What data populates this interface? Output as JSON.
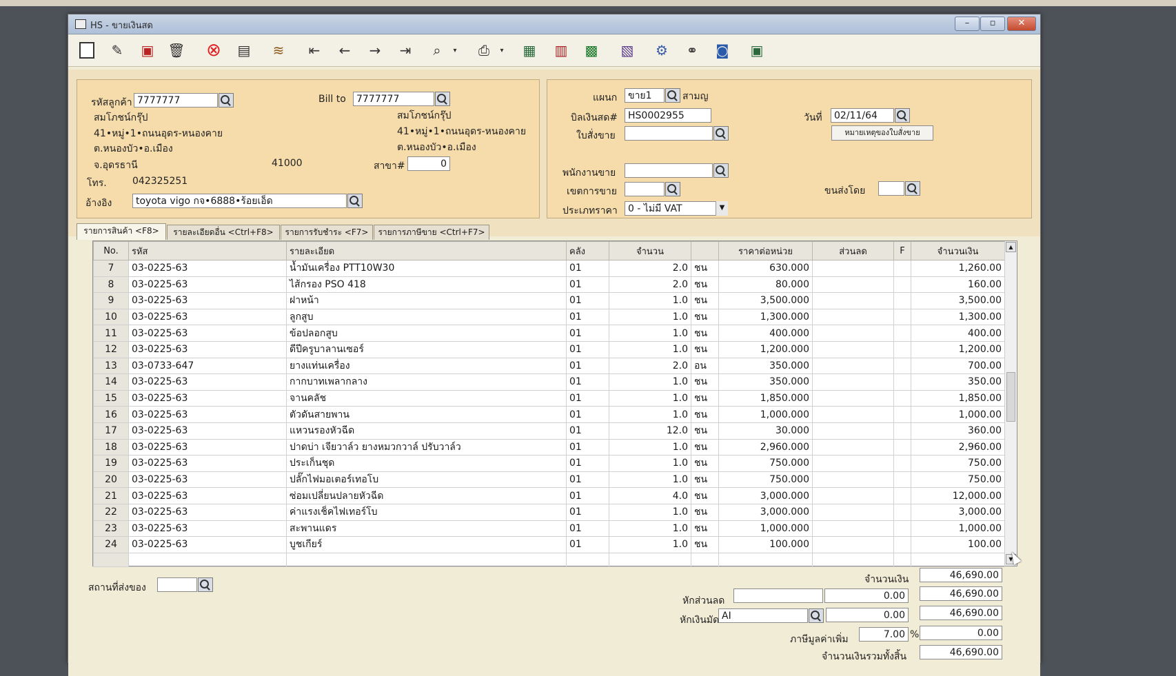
{
  "window": {
    "title": "HS - ขายเงินสด"
  },
  "header": {
    "customer_code_label": "รหัสลูกค้า",
    "customer_code": "7777777",
    "customer_name": "สมโภชน์กรุ๊ป",
    "customer_addr1": "41•หมู่•1•ถนนอุดร-หนองคาย",
    "customer_addr2": "ต.หนองบัว•อ.เมือง",
    "customer_province": "จ.อุดรธานี",
    "customer_zip": "41000",
    "phone_label": "โทร.",
    "phone": "042325251",
    "reference_label": "อ้างอิง",
    "reference": "toyota vigo กจ•6888•ร้อยเอ็ด",
    "bill_to_label": "Bill to",
    "bill_to_code": "7777777",
    "bill_to_name": "สมโภชน์กรุ๊ป",
    "bill_to_addr1": "41•หมู่•1•ถนนอุดร-หนองคาย",
    "bill_to_addr2": "ต.หนองบัว•อ.เมือง",
    "branch_label": "สาขา#",
    "branch": "0",
    "department_label": "แผนก",
    "department": "ขาย1",
    "department_name": "สามญ",
    "cash_bill_label": "บิลเงินสด#",
    "cash_bill": "HS0002955",
    "sales_order_label": "ใบสั่งขาย",
    "sales_order": "",
    "date_label": "วันที่",
    "date": "02/11/64",
    "order_note_button": "หมายเหตุของใบสั่งขาย",
    "salesperson_label": "พนักงานขาย",
    "salesperson": "",
    "sales_area_label": "เขตการขาย",
    "sales_area": "",
    "shipped_by_label": "ขนส่งโดย",
    "shipped_by": "",
    "price_type_label": "ประเภทราคา",
    "price_type": "0 - ไม่มี VAT"
  },
  "tabs": [
    {
      "label": "รายการสินค้า <F8>"
    },
    {
      "label": "รายละเอียดอื่น <Ctrl+F8>"
    },
    {
      "label": "รายการรับชำระ <F7>"
    },
    {
      "label": "รายการภาษีขาย <Ctrl+F7>"
    }
  ],
  "grid": {
    "columns": [
      "No.",
      "รหัส",
      "รายละเอียด",
      "คลัง",
      "จำนวน",
      "",
      "ราคาต่อหน่วย",
      "ส่วนลด",
      "F",
      "จำนวนเงิน"
    ],
    "rows": [
      [
        "7",
        "03-0225-63",
        "น้ำมันเครื่อง PTT10W30",
        "01",
        "2.0",
        "ชน",
        "630.000",
        "",
        "",
        "1,260.00"
      ],
      [
        "8",
        "03-0225-63",
        "ไส้กรอง PSO 418",
        "01",
        "2.0",
        "ชน",
        "80.000",
        "",
        "",
        "160.00"
      ],
      [
        "9",
        "03-0225-63",
        "ฝาหน้า",
        "01",
        "1.0",
        "ชน",
        "3,500.000",
        "",
        "",
        "3,500.00"
      ],
      [
        "10",
        "03-0225-63",
        "ลูกสูบ",
        "01",
        "1.0",
        "ชน",
        "1,300.000",
        "",
        "",
        "1,300.00"
      ],
      [
        "11",
        "03-0225-63",
        "ข้อปลอกสูบ",
        "01",
        "1.0",
        "ชน",
        "400.000",
        "",
        "",
        "400.00"
      ],
      [
        "12",
        "03-0225-63",
        "ดีปีครูบาลานเซอร์",
        "01",
        "1.0",
        "ชน",
        "1,200.000",
        "",
        "",
        "1,200.00"
      ],
      [
        "13",
        "03-0733-647",
        "ยางแท่นเครื่อง",
        "01",
        "2.0",
        "อน",
        "350.000",
        "",
        "",
        "700.00"
      ],
      [
        "14",
        "03-0225-63",
        "กากบาทเพลากลาง",
        "01",
        "1.0",
        "ชน",
        "350.000",
        "",
        "",
        "350.00"
      ],
      [
        "15",
        "03-0225-63",
        "จานคลัช",
        "01",
        "1.0",
        "ชน",
        "1,850.000",
        "",
        "",
        "1,850.00"
      ],
      [
        "16",
        "03-0225-63",
        "ตัวดันสายพาน",
        "01",
        "1.0",
        "ชน",
        "1,000.000",
        "",
        "",
        "1,000.00"
      ],
      [
        "17",
        "03-0225-63",
        "แหวนรองหัวฉีด",
        "01",
        "12.0",
        "ชน",
        "30.000",
        "",
        "",
        "360.00"
      ],
      [
        "18",
        "03-0225-63",
        "ปาดบ่า เจียวาล์ว ยางหมวกวาล์ ปรับวาล์ว",
        "01",
        "1.0",
        "ชน",
        "2,960.000",
        "",
        "",
        "2,960.00"
      ],
      [
        "19",
        "03-0225-63",
        "ประเก็นชุด",
        "01",
        "1.0",
        "ชน",
        "750.000",
        "",
        "",
        "750.00"
      ],
      [
        "20",
        "03-0225-63",
        "ปลั๊กไฟมอเตอร์เทอโบ",
        "01",
        "1.0",
        "ชน",
        "750.000",
        "",
        "",
        "750.00"
      ],
      [
        "21",
        "03-0225-63",
        "ซ่อมเปลี่ยนปลายหัวฉีด",
        "01",
        "4.0",
        "ชน",
        "3,000.000",
        "",
        "",
        "12,000.00"
      ],
      [
        "22",
        "03-0225-63",
        "ค่าแรงเช็คไฟเทอร์โบ",
        "01",
        "1.0",
        "ชน",
        "3,000.000",
        "",
        "",
        "3,000.00"
      ],
      [
        "23",
        "03-0225-63",
        "สะพานแดร",
        "01",
        "1.0",
        "ชน",
        "1,000.000",
        "",
        "",
        "1,000.00"
      ],
      [
        "24",
        "03-0225-63",
        "บูชเกียร์",
        "01",
        "1.0",
        "ชน",
        "100.000",
        "",
        "",
        "100.00"
      ]
    ]
  },
  "footer": {
    "delivery_place_label": "สถานที่ส่งของ",
    "delivery_place": "",
    "amount_label": "จำนวนเงิน",
    "amount": "46,690.00",
    "discount_label": "หักส่วนลด",
    "discount_text": "",
    "discount_value": "0.00",
    "after_discount": "46,690.00",
    "deposit_label": "หักเงินมัดจำ",
    "deposit_code": "AI",
    "deposit_value": "0.00",
    "after_deposit": "46,690.00",
    "vat_label": "ภาษีมูลค่าเพิ่ม",
    "vat_rate": "7.00",
    "vat_percent_sign": "%",
    "vat_amount": "0.00",
    "grand_total_label": "จำนวนเงินรวมทั้งสิ้น",
    "grand_total": "46,690.00"
  },
  "icons": {
    "toolbar": [
      "new-doc-icon",
      "edit-icon",
      "copy-icon",
      "delete-icon",
      "cancel-icon",
      "save-icon",
      "approve-icon",
      "first-icon",
      "prev-icon",
      "next-icon",
      "last-icon",
      "find-icon",
      "print-icon",
      "report1-icon",
      "report2-icon",
      "report3-icon",
      "calc-icon",
      "tools-icon",
      "link-icon",
      "ok-icon",
      "export-icon"
    ]
  }
}
